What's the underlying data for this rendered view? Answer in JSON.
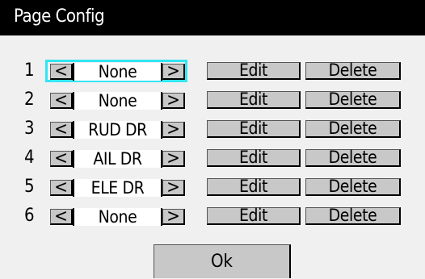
{
  "window": {
    "title": "Page Config"
  },
  "icons": {
    "prev": "chevron-left-icon",
    "next": "chevron-right-icon"
  },
  "colors": {
    "focus": "#33e5f2",
    "titlebar": "#000000",
    "button": "#c8c8c8"
  },
  "rows": [
    {
      "number": "1",
      "value": "None",
      "prev": "<",
      "next": ">",
      "edit": "Edit",
      "delete": "Delete",
      "focused": true
    },
    {
      "number": "2",
      "value": "None",
      "prev": "<",
      "next": ">",
      "edit": "Edit",
      "delete": "Delete",
      "focused": false
    },
    {
      "number": "3",
      "value": "RUD DR",
      "prev": "<",
      "next": ">",
      "edit": "Edit",
      "delete": "Delete",
      "focused": false
    },
    {
      "number": "4",
      "value": "AIL DR",
      "prev": "<",
      "next": ">",
      "edit": "Edit",
      "delete": "Delete",
      "focused": false
    },
    {
      "number": "5",
      "value": "ELE DR",
      "prev": "<",
      "next": ">",
      "edit": "Edit",
      "delete": "Delete",
      "focused": false
    },
    {
      "number": "6",
      "value": "None",
      "prev": "<",
      "next": ">",
      "edit": "Edit",
      "delete": "Delete",
      "focused": false
    }
  ],
  "footer": {
    "ok_label": "Ok"
  }
}
